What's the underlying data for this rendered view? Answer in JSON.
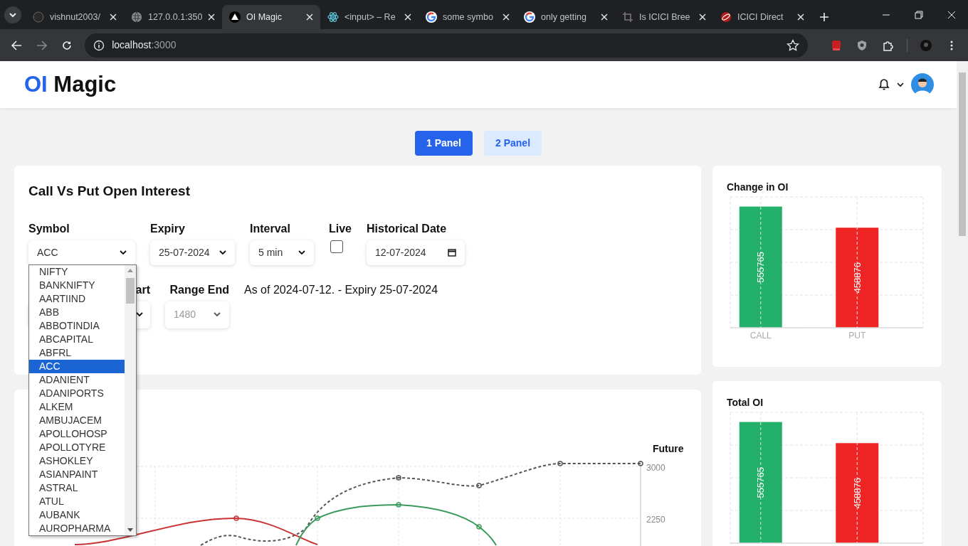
{
  "browser": {
    "tabs": [
      {
        "title": "vishnut2003/",
        "kind": "octo",
        "selected": false
      },
      {
        "title": "127.0.0.1:350",
        "kind": "globe",
        "selected": false
      },
      {
        "title": "OI Magic",
        "kind": "triangle",
        "selected": true
      },
      {
        "title": "<input> – Re",
        "kind": "atom",
        "selected": false
      },
      {
        "title": "some symbo",
        "kind": "ring",
        "selected": false
      },
      {
        "title": "only getting",
        "kind": "ring",
        "selected": false
      },
      {
        "title": "Is ICICI Bree",
        "kind": "crop",
        "selected": false
      },
      {
        "title": "ICICI Direct",
        "kind": "swirl",
        "selected": false
      }
    ],
    "address": {
      "host": "localhost",
      "port": ":3000"
    }
  },
  "header": {
    "logo": {
      "accent": "OI",
      "rest": "Magic"
    }
  },
  "panel_toggle": [
    {
      "label": "1 Panel",
      "selected": true
    },
    {
      "label": "2 Panel",
      "selected": false
    }
  ],
  "oi_card": {
    "title": "Call Vs Put Open Interest",
    "fields": [
      {
        "kind": "select",
        "label": "Symbol",
        "value": "ACC"
      },
      {
        "kind": "select",
        "label": "Expiry",
        "value": "25-07-2024"
      },
      {
        "kind": "select",
        "label": "Interval",
        "value": "5 min"
      },
      {
        "kind": "checkbox",
        "label": "Live",
        "checked": false
      },
      {
        "kind": "date",
        "label": "Historical Date",
        "value": "12-07-2024"
      }
    ],
    "range_fields": [
      {
        "label": "art",
        "disabled": false
      },
      {
        "label": "Range End",
        "value": "1480",
        "disabled": true
      }
    ],
    "summary": "As of 2024-07-12. - Expiry 25-07-2024"
  },
  "symbol_dropdown": {
    "options": [
      {
        "label": "NIFTY",
        "selected": false
      },
      {
        "label": "BANKNIFTY",
        "selected": false
      },
      {
        "label": "AARTIIND",
        "selected": false
      },
      {
        "label": "ABB",
        "selected": false
      },
      {
        "label": "ABBOTINDIA",
        "selected": false
      },
      {
        "label": "ABCAPITAL",
        "selected": false
      },
      {
        "label": "ABFRL",
        "selected": false
      },
      {
        "label": "ACC",
        "selected": true
      },
      {
        "label": "ADANIENT",
        "selected": false
      },
      {
        "label": "ADANIPORTS",
        "selected": false
      },
      {
        "label": "ALKEM",
        "selected": false
      },
      {
        "label": "AMBUJACEM",
        "selected": false
      },
      {
        "label": "APOLLOHOSP",
        "selected": false
      },
      {
        "label": "APOLLOTYRE",
        "selected": false
      },
      {
        "label": "ASHOKLEY",
        "selected": false
      },
      {
        "label": "ASIANPAINT",
        "selected": false
      },
      {
        "label": "ASTRAL",
        "selected": false
      },
      {
        "label": "ATUL",
        "selected": false
      },
      {
        "label": "AUBANK",
        "selected": false
      },
      {
        "label": "AUROPHARMA",
        "selected": false
      }
    ]
  },
  "line_chart": {
    "axis_title": "Future",
    "tick_labels": [
      "3000",
      "2250"
    ]
  },
  "side_charts": [
    {
      "title": "Change in OI",
      "chart_data": {
        "type": "bar",
        "categories": [
          "CALL",
          "PUT"
        ],
        "ylim": [
          0,
          600000
        ],
        "data_labels": true,
        "series": [
          {
            "color": "#22b06b",
            "values": [
              555765,
              null
            ]
          },
          {
            "color": "#ee2524",
            "values": [
              null,
              458876
            ]
          }
        ]
      }
    },
    {
      "title": "Total OI",
      "chart_data": {
        "type": "bar",
        "ylim": [
          0,
          600000
        ],
        "data_labels": true,
        "series": [
          {
            "color": "#22b06b",
            "values": [
              555765,
              null
            ]
          },
          {
            "color": "#ee2524",
            "values": [
              null,
              458876
            ]
          }
        ]
      }
    }
  ]
}
